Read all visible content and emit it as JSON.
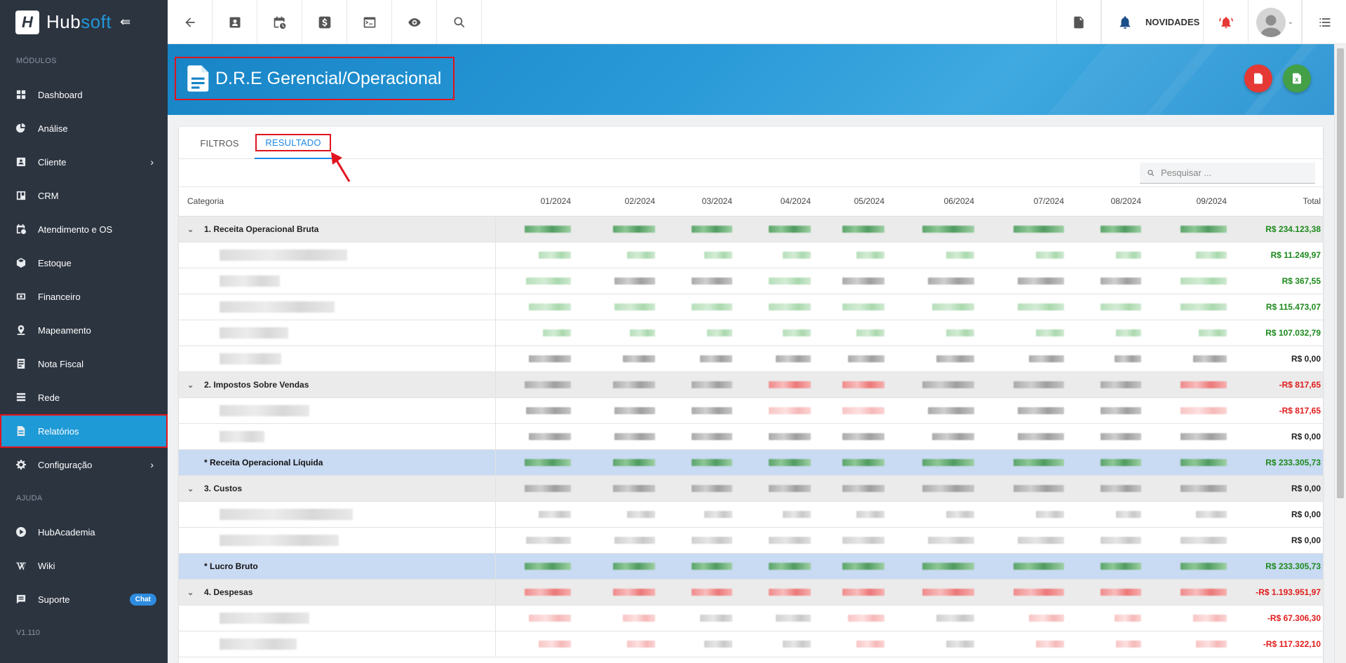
{
  "app": {
    "logo_text_1": "Hub",
    "logo_text_2": "soft",
    "version": "V1.110"
  },
  "sidebar": {
    "section_modules": "MÓDULOS",
    "section_help": "AJUDA",
    "items": [
      {
        "label": "Dashboard",
        "icon": "dashboard-icon"
      },
      {
        "label": "Análise",
        "icon": "pie-chart-icon"
      },
      {
        "label": "Cliente",
        "icon": "contact-card-icon",
        "has_submenu": true
      },
      {
        "label": "CRM",
        "icon": "crm-board-icon"
      },
      {
        "label": "Atendimento e OS",
        "icon": "calendar-clock-icon"
      },
      {
        "label": "Estoque",
        "icon": "box-icon"
      },
      {
        "label": "Financeiro",
        "icon": "money-icon"
      },
      {
        "label": "Mapeamento",
        "icon": "map-pin-icon"
      },
      {
        "label": "Nota Fiscal",
        "icon": "invoice-icon"
      },
      {
        "label": "Rede",
        "icon": "network-icon"
      },
      {
        "label": "Relatórios",
        "icon": "report-file-icon",
        "active": true
      },
      {
        "label": "Configuração",
        "icon": "gear-icon",
        "has_submenu": true
      }
    ],
    "help_items": [
      {
        "label": "HubAcademia",
        "icon": "play-circle-icon"
      },
      {
        "label": "Wiki",
        "icon": "wikipedia-icon"
      },
      {
        "label": "Suporte",
        "icon": "chat-icon",
        "badge": "Chat"
      }
    ]
  },
  "topbar": {
    "novidades_label": "NOVIDADES"
  },
  "page": {
    "title": "D.R.E Gerencial/Operacional"
  },
  "tabs": {
    "filtros": "FILTROS",
    "resultado": "RESULTADO",
    "active": "RESULTADO"
  },
  "search": {
    "placeholder": "Pesquisar ..."
  },
  "table": {
    "headers": [
      "Categoria",
      "01/2024",
      "02/2024",
      "03/2024",
      "04/2024",
      "05/2024",
      "06/2024",
      "07/2024",
      "08/2024",
      "09/2024",
      "Total"
    ],
    "rows": [
      {
        "type": "group",
        "label": "1. Receita Operacional Bruta",
        "total": "R$ 234.123,38",
        "sign": "pos",
        "tone": "g"
      },
      {
        "type": "child",
        "label": "",
        "total": "R$ 11.249,97",
        "sign": "pos",
        "tone": "lg"
      },
      {
        "type": "child",
        "label": "",
        "total": "R$ 367,55",
        "sign": "pos",
        "tone": "mix"
      },
      {
        "type": "child",
        "label": "",
        "total": "R$ 115.473,07",
        "sign": "pos",
        "tone": "lg"
      },
      {
        "type": "child",
        "label": "",
        "total": "R$ 107.032,79",
        "sign": "pos",
        "tone": "lg"
      },
      {
        "type": "child",
        "label": "",
        "total": "R$ 0,00",
        "sign": "zero",
        "tone": "gr"
      },
      {
        "type": "group",
        "label": "2. Impostos Sobre Vendas",
        "total": "-R$ 817,65",
        "sign": "neg",
        "tone": "grr"
      },
      {
        "type": "child",
        "label": "",
        "total": "-R$ 817,65",
        "sign": "neg",
        "tone": "grlr"
      },
      {
        "type": "child",
        "label": "",
        "total": "R$ 0,00",
        "sign": "zero",
        "tone": "gr"
      },
      {
        "type": "highlight",
        "label": "* Receita Operacional Líquida",
        "total": "R$ 233.305,73",
        "sign": "pos",
        "tone": "g"
      },
      {
        "type": "group",
        "label": "3. Custos",
        "total": "R$ 0,00",
        "sign": "zero",
        "tone": "gr"
      },
      {
        "type": "child",
        "label": "",
        "total": "R$ 0,00",
        "sign": "zero",
        "tone": "lgr"
      },
      {
        "type": "child",
        "label": "",
        "total": "R$ 0,00",
        "sign": "zero",
        "tone": "lgr"
      },
      {
        "type": "highlight",
        "label": "* Lucro Bruto",
        "total": "R$ 233.305,73",
        "sign": "pos",
        "tone": "g"
      },
      {
        "type": "group",
        "label": "4. Despesas",
        "total": "-R$ 1.193.951,97",
        "sign": "neg",
        "tone": "r"
      },
      {
        "type": "child",
        "label": "",
        "total": "-R$ 67.306,30",
        "sign": "neg",
        "tone": "lr"
      },
      {
        "type": "child",
        "label": "",
        "total": "-R$ 117.322,10",
        "sign": "neg",
        "tone": "lr"
      }
    ]
  }
}
